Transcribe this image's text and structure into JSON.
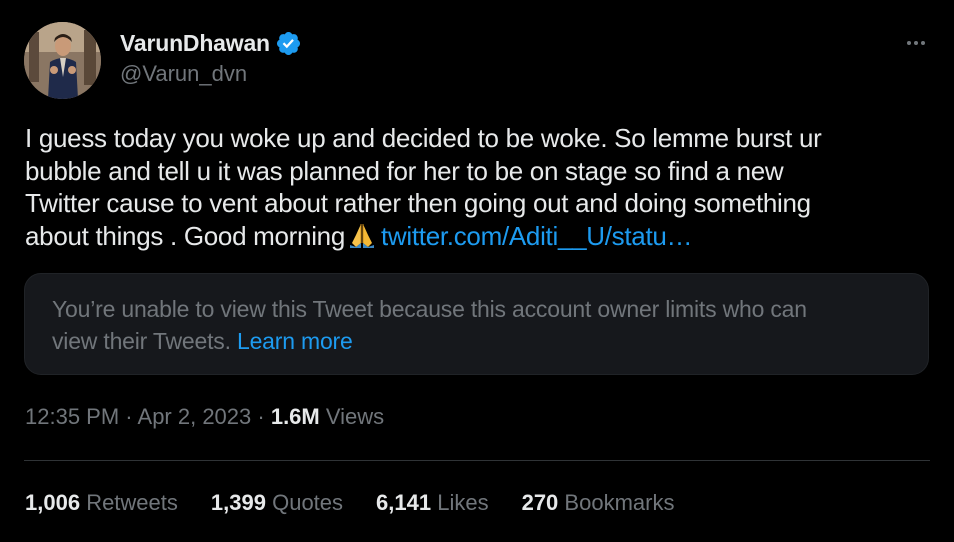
{
  "author": {
    "display_name": "VarunDhawan",
    "handle": "@Varun_dvn",
    "verified": true,
    "avatar": "profile-photo"
  },
  "tweet": {
    "lines": [
      "I guess today you woke up and decided to be woke. So lemme burst ur",
      "bubble and tell u it was planned for her to be on stage so find a new",
      "Twitter cause to vent about rather then going out and doing something",
      "about things . Good morning"
    ],
    "emoji": "folded-hands-emoji",
    "link": "twitter.com/Aditi__U/statu…"
  },
  "quoted_tweet": {
    "message_line1": "You’re unable to view this Tweet because this account owner limits who can",
    "message_line2": "view their Tweets.",
    "learn_more": "Learn more"
  },
  "meta": {
    "time": "12:35 PM",
    "separator": " · ",
    "date": "Apr 2, 2023",
    "views_count": "1.6M",
    "views_label": "Views"
  },
  "stats": [
    {
      "count": "1,006",
      "label": "Retweets"
    },
    {
      "count": "1,399",
      "label": "Quotes"
    },
    {
      "count": "6,141",
      "label": "Likes"
    },
    {
      "count": "270",
      "label": "Bookmarks"
    }
  ],
  "colors": {
    "background": "#000000",
    "text_primary": "#e7e9ea",
    "text_secondary": "#71767b",
    "link": "#1d9bf0",
    "verified_badge": "#1d9bf0",
    "quote_background": "#16181c",
    "divider": "#2f3336"
  },
  "icons": {
    "verified": "verified-badge-icon",
    "more": "more-dots-icon"
  }
}
